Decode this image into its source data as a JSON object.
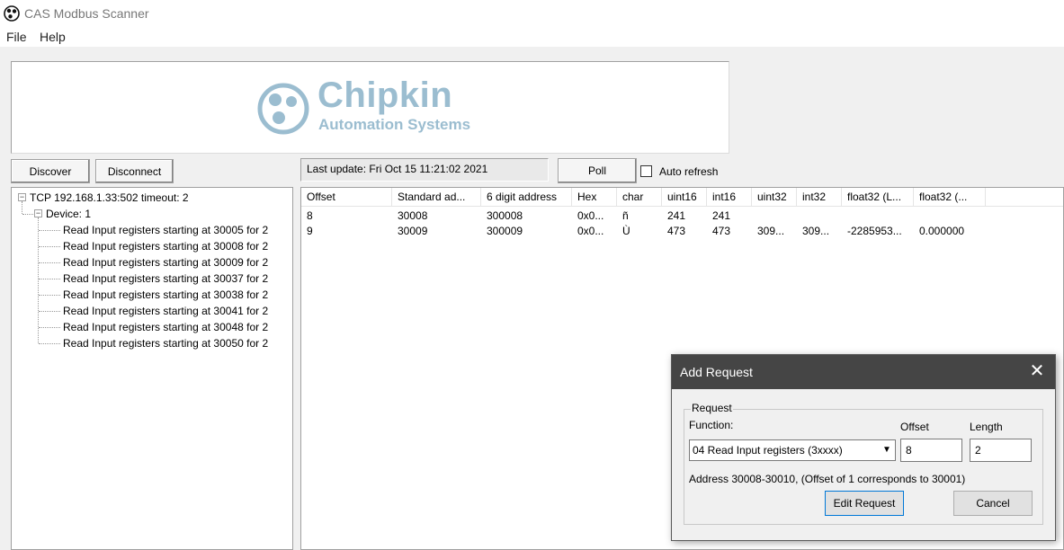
{
  "window": {
    "title": "CAS Modbus Scanner",
    "icon": "network-node-icon"
  },
  "menu": {
    "items": [
      "File",
      "Help"
    ]
  },
  "logo": {
    "name": "Chipkin",
    "subtitle": "Automation Systems",
    "color": "#9bbdd0"
  },
  "toolbar": {
    "discover_label": "Discover",
    "disconnect_label": "Disconnect",
    "last_update": "Last update: Fri Oct 15 11:21:02 2021",
    "poll_label": "Poll",
    "auto_refresh_label": "Auto refresh",
    "auto_refresh_checked": false
  },
  "tree": {
    "connection": "TCP 192.168.1.33:502 timeout: 2",
    "device": "Device: 1",
    "requests": [
      "Read Input registers starting at 30005 for 2",
      "Read Input registers starting at 30008 for 2",
      "Read Input registers starting at 30009 for 2",
      "Read Input registers starting at 30037 for 2",
      "Read Input registers starting at 30038 for 2",
      "Read Input registers starting at 30041 for 2",
      "Read Input registers starting at 30048 for 2",
      "Read Input registers starting at 30050 for 2"
    ]
  },
  "grid": {
    "columns": [
      "Offset",
      "Standard ad...",
      "6 digit address",
      "Hex",
      "char",
      "uint16",
      "int16",
      "uint32",
      "int32",
      "float32 (L...",
      "float32 (..."
    ],
    "rows": [
      [
        "8",
        "30008",
        "300008",
        "0x0...",
        "ñ",
        "241",
        "241",
        "",
        "",
        "",
        ""
      ],
      [
        "9",
        "30009",
        "300009",
        "0x0...",
        "Ù",
        "473",
        "473",
        "309...",
        "309...",
        "-2285953...",
        "0.000000"
      ]
    ]
  },
  "dialog": {
    "title": "Add Request",
    "group_label": "Request",
    "function_label": "Function:",
    "function_value": "04 Read Input registers (3xxxx)",
    "offset_label": "Offset",
    "offset_value": "8",
    "length_label": "Length",
    "length_value": "2",
    "address_note": "Address 30008-30010, (Offset of 1 corresponds to 30001)",
    "edit_label": "Edit Request",
    "cancel_label": "Cancel"
  }
}
